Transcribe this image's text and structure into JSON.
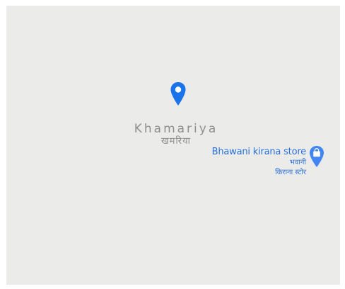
{
  "map": {
    "place": {
      "name": "Khamariya",
      "name_local": "खमरिया",
      "pin_icon": "location-pin-icon",
      "pin_color": "#1a73e8"
    },
    "poi": {
      "name": "Bhawani kirana store",
      "name_local_line1": "भवानी",
      "name_local_line2": "किराना स्टोर",
      "icon": "shopping-bag-icon",
      "color": "#4285f4",
      "label_color": "#2b72d6"
    },
    "background_color": "#ebebea"
  }
}
